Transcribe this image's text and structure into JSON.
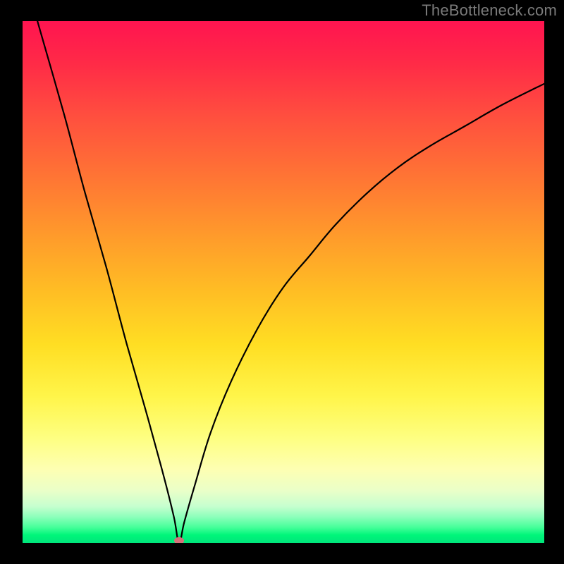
{
  "watermark": "TheBottleneck.com",
  "colors": {
    "background": "#000000",
    "curve": "#000000",
    "marker": "#d6717a"
  },
  "chart_data": {
    "type": "line",
    "title": "",
    "xlabel": "",
    "ylabel": "",
    "xlim": [
      0,
      100
    ],
    "ylim": [
      0,
      100
    ],
    "grid": false,
    "legend": false,
    "annotations": [
      {
        "name": "minimum-marker",
        "x": 30,
        "y": 0
      }
    ],
    "series": [
      {
        "name": "bottleneck-curve",
        "x": [
          0,
          4,
          8,
          12,
          16,
          20,
          24,
          27,
          29,
          30,
          31,
          33,
          36,
          40,
          45,
          50,
          55,
          60,
          66,
          72,
          78,
          85,
          92,
          100
        ],
        "values": [
          110,
          96,
          82,
          67,
          53,
          38,
          24,
          13,
          5,
          0,
          4,
          11,
          21,
          31,
          41,
          49,
          55,
          61,
          67,
          72,
          76,
          80,
          84,
          88
        ]
      }
    ]
  }
}
